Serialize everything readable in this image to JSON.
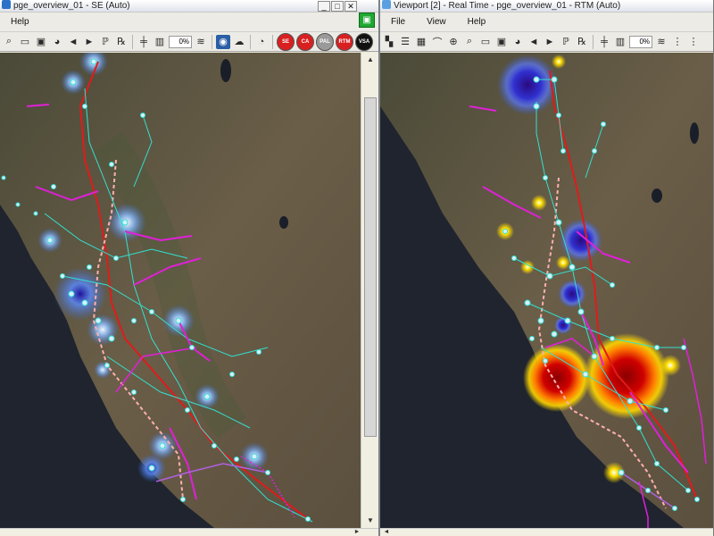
{
  "left_window": {
    "title": "pge_overview_01 - SE (Auto)",
    "menu": [
      "Help"
    ],
    "zoom_value": "0%",
    "buttons": [
      "SE",
      "CA",
      "PAL",
      "RTM",
      "VSA"
    ]
  },
  "right_window": {
    "title": "Viewport [2] - Real Time - pge_overview_01 - RTM (Auto)",
    "menu": [
      "File",
      "View",
      "Help"
    ],
    "zoom_value": "0%"
  },
  "colors": {
    "map_base": "#3a3a30",
    "ocean": "#1f242e",
    "line_cyan": "#33e0d0",
    "line_magenta": "#e020d8",
    "line_red": "#e01b1b",
    "line_pink": "#ffb0b0",
    "glow_blue": "#6aa8ff",
    "hot_red": "#d00000",
    "hot_yellow": "#ffd800"
  },
  "icons": [
    "window-icon",
    "minimize-icon",
    "maximize-icon",
    "close-icon",
    "toolbar-icons",
    "green-network-icon"
  ]
}
